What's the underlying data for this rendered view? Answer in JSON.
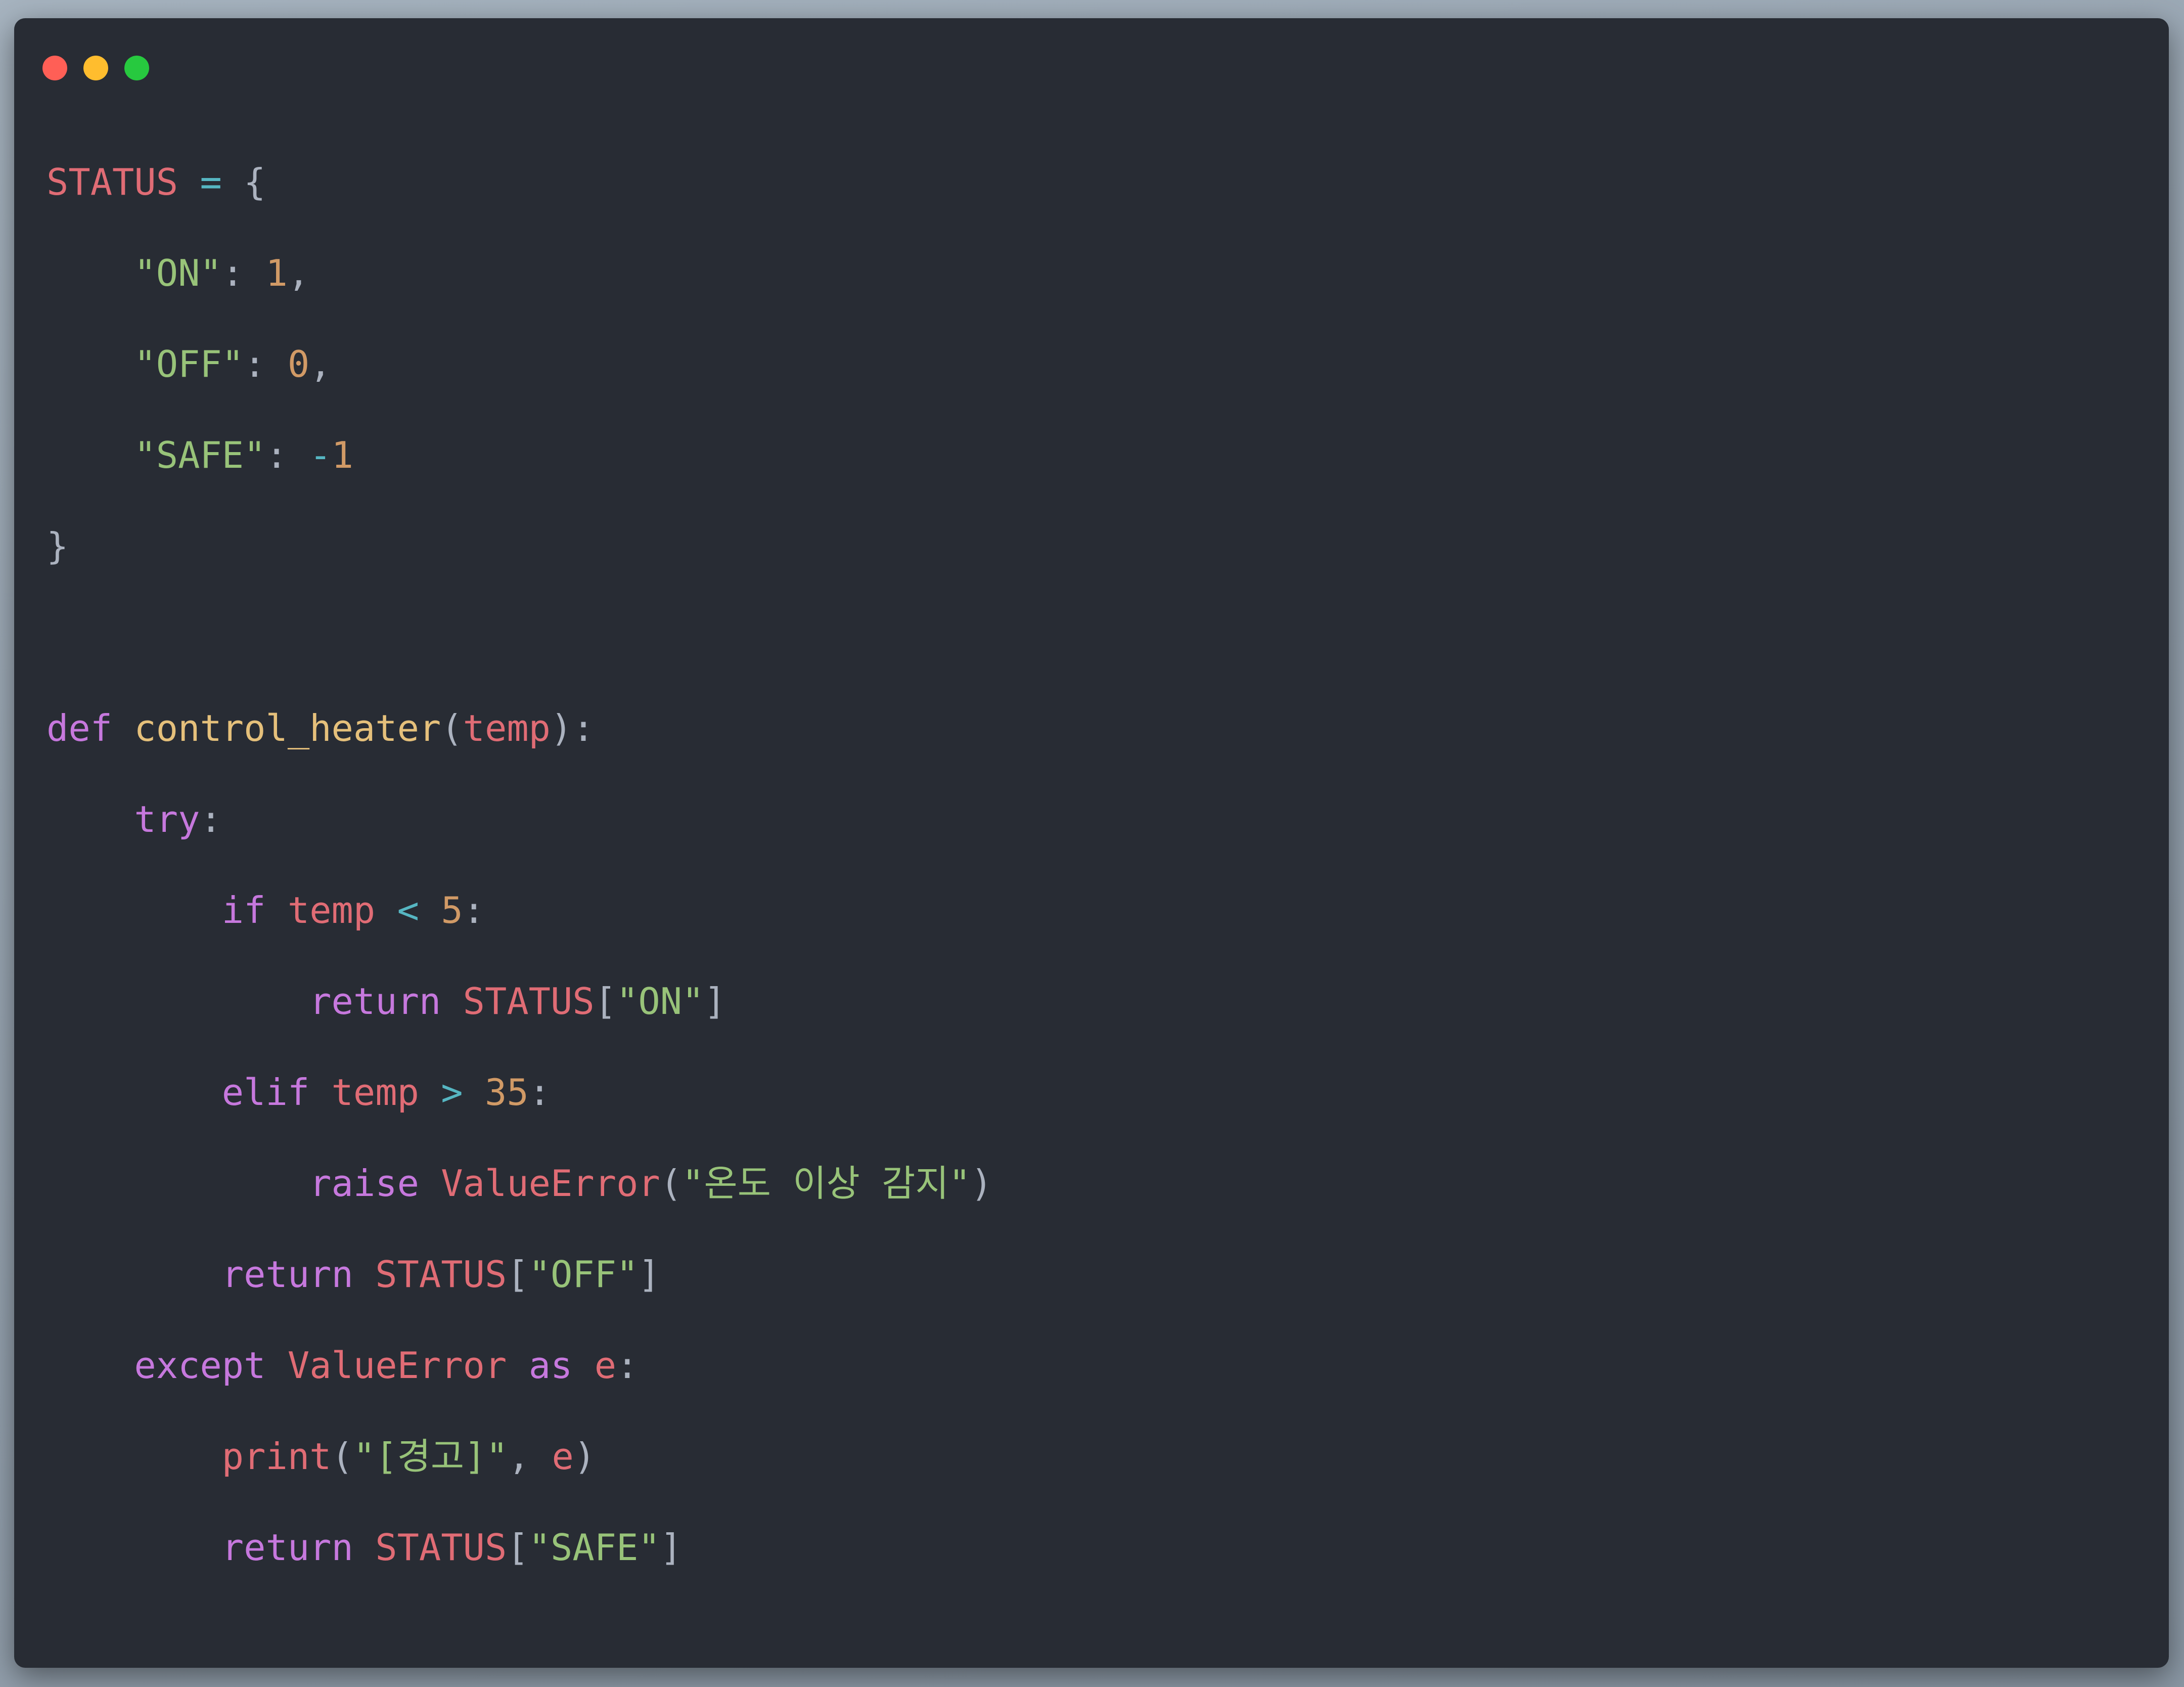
{
  "window": {
    "traffic_lights": [
      {
        "name": "close",
        "color": "#ff5f56"
      },
      {
        "name": "minimize",
        "color": "#ffbd2e"
      },
      {
        "name": "zoom",
        "color": "#27c93f"
      }
    ]
  },
  "colors": {
    "background": "#282c34",
    "variable": "#e06c75",
    "operator": "#56b6c2",
    "punctuation": "#abb2bf",
    "string": "#98c379",
    "number": "#d19a66",
    "keyword": "#c678dd",
    "function": "#e5c07b"
  },
  "code": {
    "language": "python",
    "lines": [
      [
        [
          "var",
          "STATUS"
        ],
        [
          "plain",
          " "
        ],
        [
          "op",
          "="
        ],
        [
          "plain",
          " "
        ],
        [
          "punc",
          "{"
        ]
      ],
      [
        [
          "plain",
          "    "
        ],
        [
          "str",
          "\"ON\""
        ],
        [
          "punc",
          ":"
        ],
        [
          "plain",
          " "
        ],
        [
          "num",
          "1"
        ],
        [
          "punc",
          ","
        ]
      ],
      [
        [
          "plain",
          "    "
        ],
        [
          "str",
          "\"OFF\""
        ],
        [
          "punc",
          ":"
        ],
        [
          "plain",
          " "
        ],
        [
          "num",
          "0"
        ],
        [
          "punc",
          ","
        ]
      ],
      [
        [
          "plain",
          "    "
        ],
        [
          "str",
          "\"SAFE\""
        ],
        [
          "punc",
          ":"
        ],
        [
          "plain",
          " "
        ],
        [
          "op",
          "-"
        ],
        [
          "num",
          "1"
        ]
      ],
      [
        [
          "punc",
          "}"
        ]
      ],
      [],
      [
        [
          "kw",
          "def"
        ],
        [
          "plain",
          " "
        ],
        [
          "fn",
          "control_heater"
        ],
        [
          "punc",
          "("
        ],
        [
          "param",
          "temp"
        ],
        [
          "punc",
          "):"
        ]
      ],
      [
        [
          "plain",
          "    "
        ],
        [
          "kw",
          "try"
        ],
        [
          "punc",
          ":"
        ]
      ],
      [
        [
          "plain",
          "        "
        ],
        [
          "kw",
          "if"
        ],
        [
          "plain",
          " "
        ],
        [
          "var",
          "temp"
        ],
        [
          "plain",
          " "
        ],
        [
          "op",
          "<"
        ],
        [
          "plain",
          " "
        ],
        [
          "num",
          "5"
        ],
        [
          "punc",
          ":"
        ]
      ],
      [
        [
          "plain",
          "            "
        ],
        [
          "kw",
          "return"
        ],
        [
          "plain",
          " "
        ],
        [
          "var",
          "STATUS"
        ],
        [
          "punc",
          "["
        ],
        [
          "str",
          "\"ON\""
        ],
        [
          "punc",
          "]"
        ]
      ],
      [
        [
          "plain",
          "        "
        ],
        [
          "kw",
          "elif"
        ],
        [
          "plain",
          " "
        ],
        [
          "var",
          "temp"
        ],
        [
          "plain",
          " "
        ],
        [
          "op",
          ">"
        ],
        [
          "plain",
          " "
        ],
        [
          "num",
          "35"
        ],
        [
          "punc",
          ":"
        ]
      ],
      [
        [
          "plain",
          "            "
        ],
        [
          "kw",
          "raise"
        ],
        [
          "plain",
          " "
        ],
        [
          "cls",
          "ValueError"
        ],
        [
          "punc",
          "("
        ],
        [
          "str",
          "\"온도 이상 감지\""
        ],
        [
          "punc",
          ")"
        ]
      ],
      [
        [
          "plain",
          "        "
        ],
        [
          "kw",
          "return"
        ],
        [
          "plain",
          " "
        ],
        [
          "var",
          "STATUS"
        ],
        [
          "punc",
          "["
        ],
        [
          "str",
          "\"OFF\""
        ],
        [
          "punc",
          "]"
        ]
      ],
      [
        [
          "plain",
          "    "
        ],
        [
          "kw",
          "except"
        ],
        [
          "plain",
          " "
        ],
        [
          "cls",
          "ValueError"
        ],
        [
          "plain",
          " "
        ],
        [
          "kw",
          "as"
        ],
        [
          "plain",
          " "
        ],
        [
          "var",
          "e"
        ],
        [
          "punc",
          ":"
        ]
      ],
      [
        [
          "plain",
          "        "
        ],
        [
          "builtin",
          "print"
        ],
        [
          "punc",
          "("
        ],
        [
          "str",
          "\"[경고]\""
        ],
        [
          "punc",
          ","
        ],
        [
          "plain",
          " "
        ],
        [
          "var",
          "e"
        ],
        [
          "punc",
          ")"
        ]
      ],
      [
        [
          "plain",
          "        "
        ],
        [
          "kw",
          "return"
        ],
        [
          "plain",
          " "
        ],
        [
          "var",
          "STATUS"
        ],
        [
          "punc",
          "["
        ],
        [
          "str",
          "\"SAFE\""
        ],
        [
          "punc",
          "]"
        ]
      ]
    ]
  }
}
